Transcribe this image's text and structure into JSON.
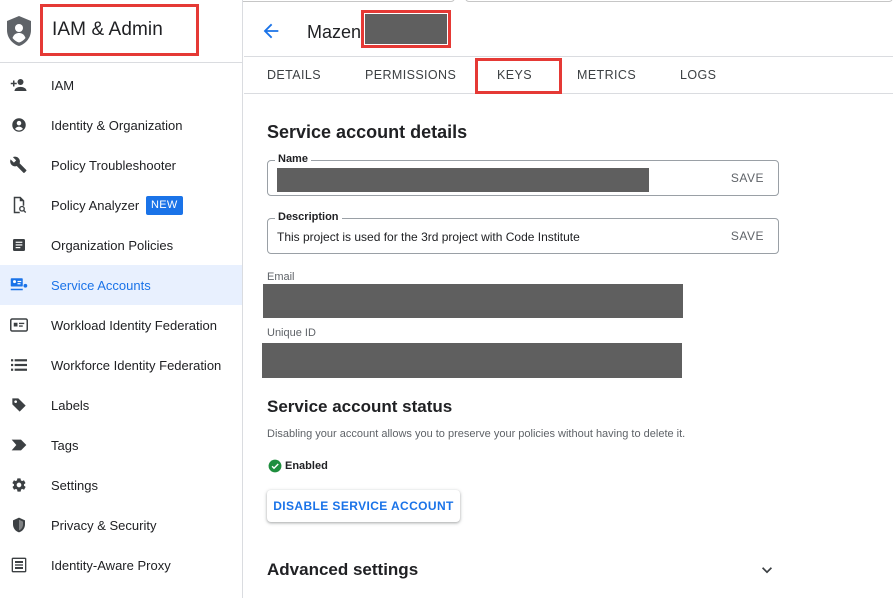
{
  "sidebar": {
    "app_title": "IAM & Admin",
    "items": [
      {
        "label": "IAM",
        "icon": "person-add-icon"
      },
      {
        "label": "Identity & Organization",
        "icon": "account-circle-icon"
      },
      {
        "label": "Policy Troubleshooter",
        "icon": "wrench-icon"
      },
      {
        "label": "Policy Analyzer",
        "icon": "document-search-icon",
        "badge": "NEW"
      },
      {
        "label": "Organization Policies",
        "icon": "article-icon"
      },
      {
        "label": "Service Accounts",
        "icon": "service-account-icon",
        "active": true
      },
      {
        "label": "Workload Identity Federation",
        "icon": "id-card-icon"
      },
      {
        "label": "Workforce Identity Federation",
        "icon": "list-icon"
      },
      {
        "label": "Labels",
        "icon": "label-icon"
      },
      {
        "label": "Tags",
        "icon": "tag-icon"
      },
      {
        "label": "Settings",
        "icon": "gear-icon"
      },
      {
        "label": "Privacy & Security",
        "icon": "shield-icon"
      },
      {
        "label": "Identity-Aware Proxy",
        "icon": "proxy-icon"
      }
    ]
  },
  "header": {
    "account_name": "Mazen-"
  },
  "tabs": [
    {
      "label": "DETAILS"
    },
    {
      "label": "PERMISSIONS"
    },
    {
      "label": "KEYS"
    },
    {
      "label": "METRICS"
    },
    {
      "label": "LOGS"
    }
  ],
  "details": {
    "title": "Service account details",
    "name_label": "Name",
    "name_save": "SAVE",
    "description_label": "Description",
    "description_value": "This project is used for the 3rd project with Code Institute",
    "description_save": "SAVE",
    "email_label": "Email",
    "unique_id_label": "Unique ID"
  },
  "status": {
    "title": "Service account status",
    "description": "Disabling your account allows you to preserve your policies without having to delete it.",
    "state": "Enabled",
    "disable_button": "DISABLE SERVICE ACCOUNT"
  },
  "advanced": {
    "title": "Advanced settings"
  },
  "colors": {
    "accent": "#1a73e8",
    "highlight_box": "#e53935",
    "active_nav_bg": "#e8f0fe",
    "status_green": "#1e8e3e",
    "redaction": "#5f5f5f"
  }
}
